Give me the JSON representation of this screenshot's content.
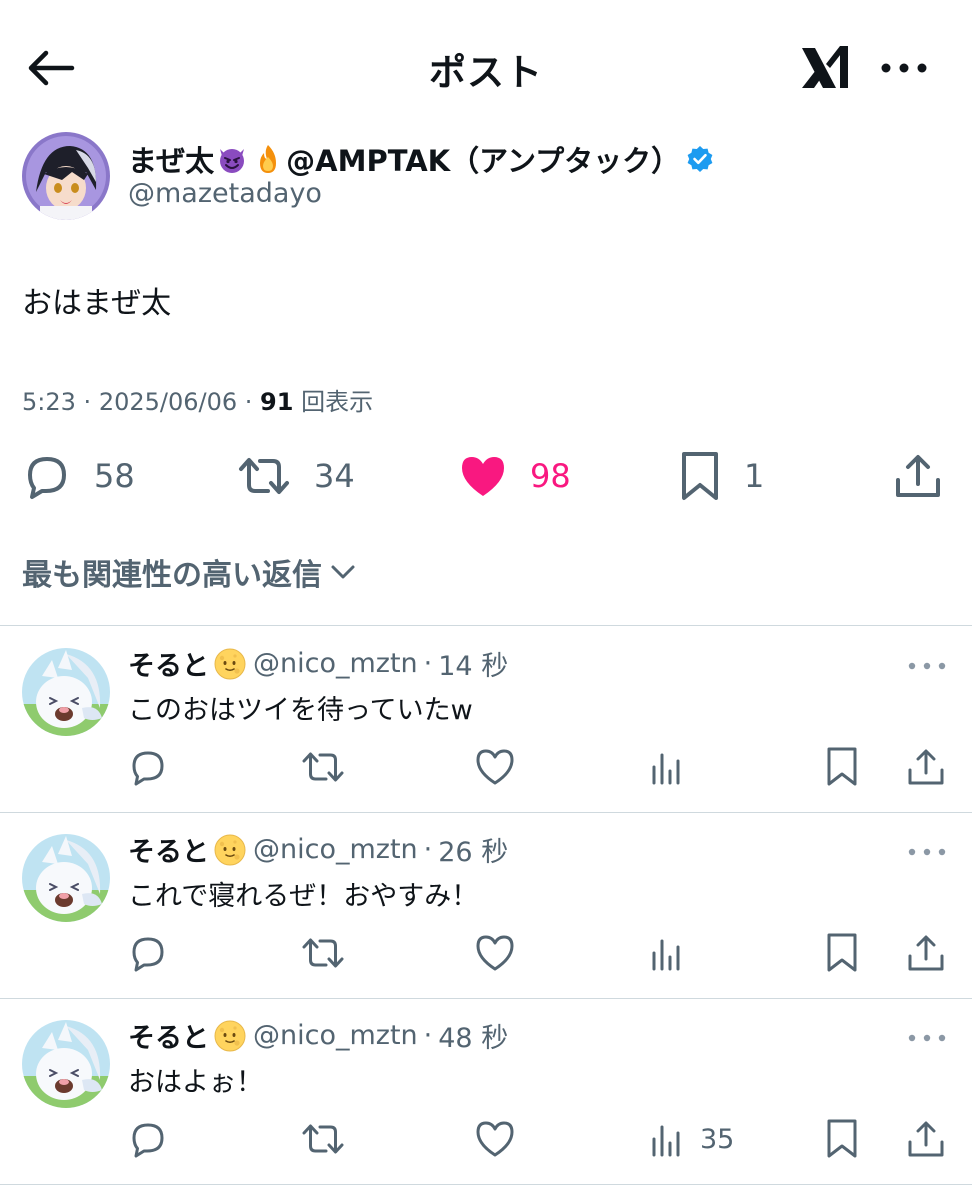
{
  "header": {
    "title": "ポスト"
  },
  "post": {
    "display_name": "まぜ太",
    "display_name_suffix": "@AMPTAK（アンプタック）",
    "handle": "@mazetadayo",
    "text": "おはまぜ太",
    "time": "5:23",
    "date": "2025/06/06",
    "views_count": "91",
    "views_label": "回表示",
    "reply_count": "58",
    "repost_count": "34",
    "like_count": "98",
    "bookmark_count": "1",
    "accent_color": "#1d9bf0",
    "like_color": "#f91880",
    "icons": {
      "name_emoji_1": "smiling-imp-emoji",
      "name_emoji_2": "fire-emoji",
      "verified": "verified-badge-icon"
    }
  },
  "sort": {
    "label": "最も関連性の高い返信"
  },
  "replies": [
    {
      "name": "そると",
      "handle": "@nico_mztn",
      "dot": "·",
      "time": "14 秒",
      "text": "このおはツイを待っていたw",
      "views": ""
    },
    {
      "name": "そると",
      "handle": "@nico_mztn",
      "dot": "·",
      "time": "26 秒",
      "text": "これで寝れるぜ！おやすみ！",
      "views": ""
    },
    {
      "name": "そると",
      "handle": "@nico_mztn",
      "dot": "·",
      "time": "48 秒",
      "text": "おはよぉ！",
      "views": "35"
    }
  ]
}
